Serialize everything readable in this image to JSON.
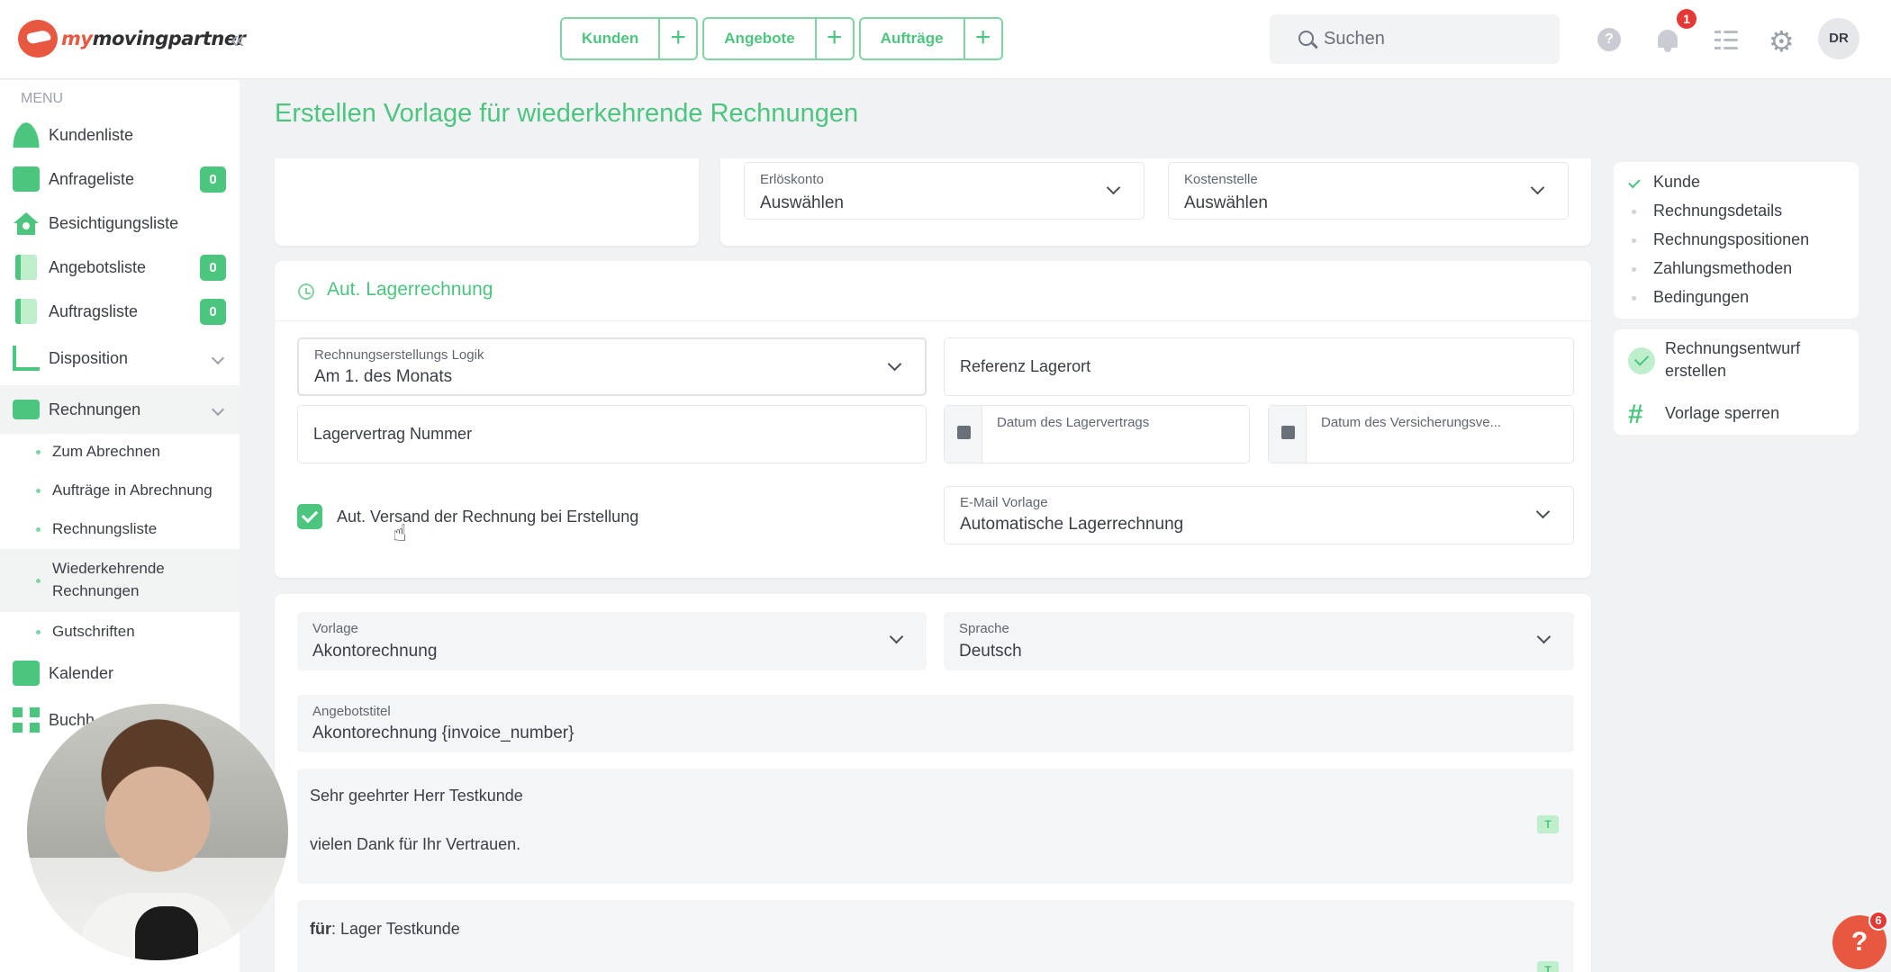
{
  "header": {
    "logo_text_a": "my",
    "logo_text_b": "moving",
    "logo_text_c": "partner",
    "quick_nav": [
      {
        "label": "Kunden"
      },
      {
        "label": "Angebote"
      },
      {
        "label": "Aufträge"
      }
    ],
    "search_placeholder": "Suchen",
    "help_label": "?",
    "notification_count": "1",
    "avatar_initials": "DR"
  },
  "sidebar": {
    "menu_caption": "MENU",
    "items": [
      {
        "label": "Kundenliste",
        "icon": "users-icon"
      },
      {
        "label": "Anfrageliste",
        "icon": "inbox-icon",
        "badge": "0"
      },
      {
        "label": "Besichtigungsliste",
        "icon": "house-icon"
      },
      {
        "label": "Angebotsliste",
        "icon": "document-icon",
        "badge": "0"
      },
      {
        "label": "Auftragsliste",
        "icon": "pdf-icon",
        "badge": "0"
      },
      {
        "label": "Disposition",
        "icon": "gantt-icon"
      },
      {
        "label": "Rechnungen",
        "icon": "money-icon"
      }
    ],
    "sub_items": [
      {
        "label": "Zum Abrechnen"
      },
      {
        "label": "Aufträge in Abrechnung"
      },
      {
        "label": "Rechnungsliste"
      },
      {
        "label": "Wiederkehrende Rechnungen",
        "line1": "Wiederkehrende",
        "line2": "Rechnungen"
      },
      {
        "label": "Gutschriften"
      }
    ],
    "items_after": [
      {
        "label": "Kalender",
        "icon": "calendar-icon"
      },
      {
        "label": "Buchh",
        "icon": "calculator-icon"
      }
    ]
  },
  "main": {
    "page_title": "Erstellen Vorlage für wiederkehrende Rechnungen",
    "top_fields": {
      "erloeskonto": {
        "label": "Erlöskonto",
        "value": "Auswählen"
      },
      "kostenstelle": {
        "label": "Kostenstelle",
        "value": "Auswählen"
      }
    },
    "storage": {
      "title": "Aut. Lagerrechnung",
      "logic": {
        "label": "Rechnungserstellungs Logik",
        "value": "Am 1. des Monats"
      },
      "referenz_placeholder": "Referenz Lagerort",
      "vertrag_nummer_placeholder": "Lagervertrag Nummer",
      "datum_vertrag_label": "Datum des Lagervertrags",
      "datum_versicherung_label": "Datum des Versicherungsve...",
      "auto_send_label": "Aut. Versand der Rechnung bei Erstellung",
      "email_template": {
        "label": "E-Mail Vorlage",
        "value": "Automatische Lagerrechnung"
      }
    },
    "document": {
      "vorlage": {
        "label": "Vorlage",
        "value": "Akontorechnung"
      },
      "sprache": {
        "label": "Sprache",
        "value": "Deutsch"
      },
      "angebotstitel": {
        "label": "Angebotstitel",
        "value": "Akontorechnung {invoice_number}"
      },
      "intro_line1": "Sehr geehrter Herr Testkunde",
      "intro_line2": "vielen Dank für Ihr Vertrauen.",
      "for_bold": "für",
      "for_rest": ": Lager Testkunde"
    }
  },
  "right_panel": {
    "steps": [
      {
        "label": "Kunde",
        "done": true
      },
      {
        "label": "Rechnungsdetails",
        "done": false
      },
      {
        "label": "Rechnungspositionen",
        "done": false
      },
      {
        "label": "Zahlungsmethoden",
        "done": false
      },
      {
        "label": "Bedingungen",
        "done": false
      }
    ],
    "action_draft_line1": "Rechnungsentwurf",
    "action_draft_line2": "erstellen",
    "action_lock": "Vorlage sperren"
  },
  "help_fab": {
    "label": "?",
    "badge": "6"
  },
  "colors": {
    "accent": "#4cc57e",
    "brand": "#e8573f",
    "badge_red": "#e53935"
  }
}
